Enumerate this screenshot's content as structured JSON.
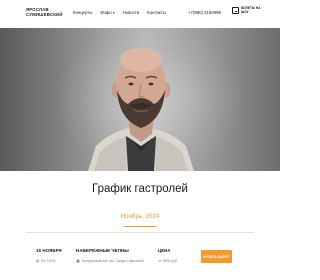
{
  "header": {
    "logo_line1": "ЯРОСЛАВ",
    "logo_line2": "СУМИШЕВСКИЙ",
    "nav": [
      {
        "label": "Концерты",
        "has_dropdown": false
      },
      {
        "label": "Инфо",
        "has_dropdown": true
      },
      {
        "label": "Новости",
        "has_dropdown": false
      },
      {
        "label": "Контакты",
        "has_dropdown": false
      }
    ],
    "phone": "+7(980) 2150999",
    "ticket_brand": "БИЛЕТЫ НА ШОУ",
    "ticket_icon": "ticket-icon"
  },
  "hero": {
    "icon": "artist-portrait"
  },
  "main": {
    "section_title": "График гастролей",
    "month": "Ноябрь, 2024",
    "events": [
      {
        "date": "19 НОЯБРЯ",
        "time": "Вт, 19:00",
        "city": "НАБЕРЕЖНЫЕ ЧЕЛНЫ",
        "venue": "Концертный зал им. Саида Сарыевой",
        "price_label": "ЦЕНА",
        "price": "от 1800 руб",
        "buy_label": "КУПИТЬ БИЛЕТ",
        "time_icon": "calendar-icon",
        "venue_icon": "location-pin-icon"
      }
    ]
  },
  "colors": {
    "accent": "#f29a2e",
    "text": "#1c1c1c",
    "muted": "#7b7b7b"
  }
}
